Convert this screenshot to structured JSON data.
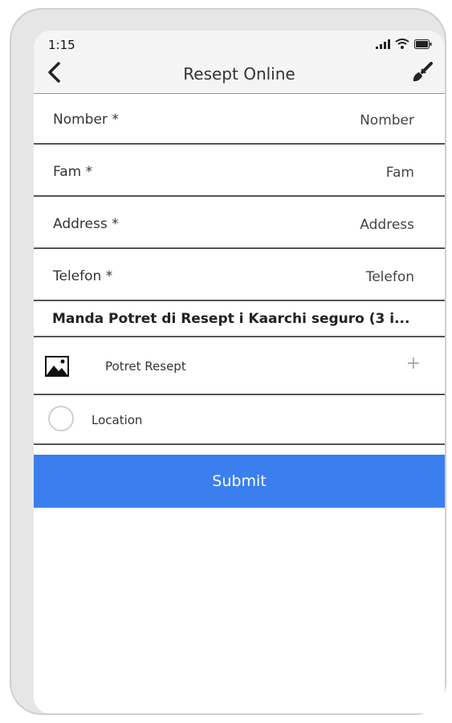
{
  "status_bar": {
    "time": "1:15"
  },
  "header": {
    "title": "Resept Online"
  },
  "fields": [
    {
      "label": "Nomber *",
      "placeholder": "Nomber"
    },
    {
      "label": "Fam *",
      "placeholder": "Fam"
    },
    {
      "label": "Address *",
      "placeholder": "Address"
    },
    {
      "label": "Telefon *",
      "placeholder": "Telefon"
    }
  ],
  "photo_section": {
    "title": "Manda Potret di Resept i Kaarchi seguro (3 i...",
    "photo_label": "Potret Resept",
    "add_symbol": "+"
  },
  "location": {
    "label": "Location"
  },
  "submit_label": "Submit",
  "colors": {
    "accent": "#3b7fef",
    "divider": "#555555"
  }
}
